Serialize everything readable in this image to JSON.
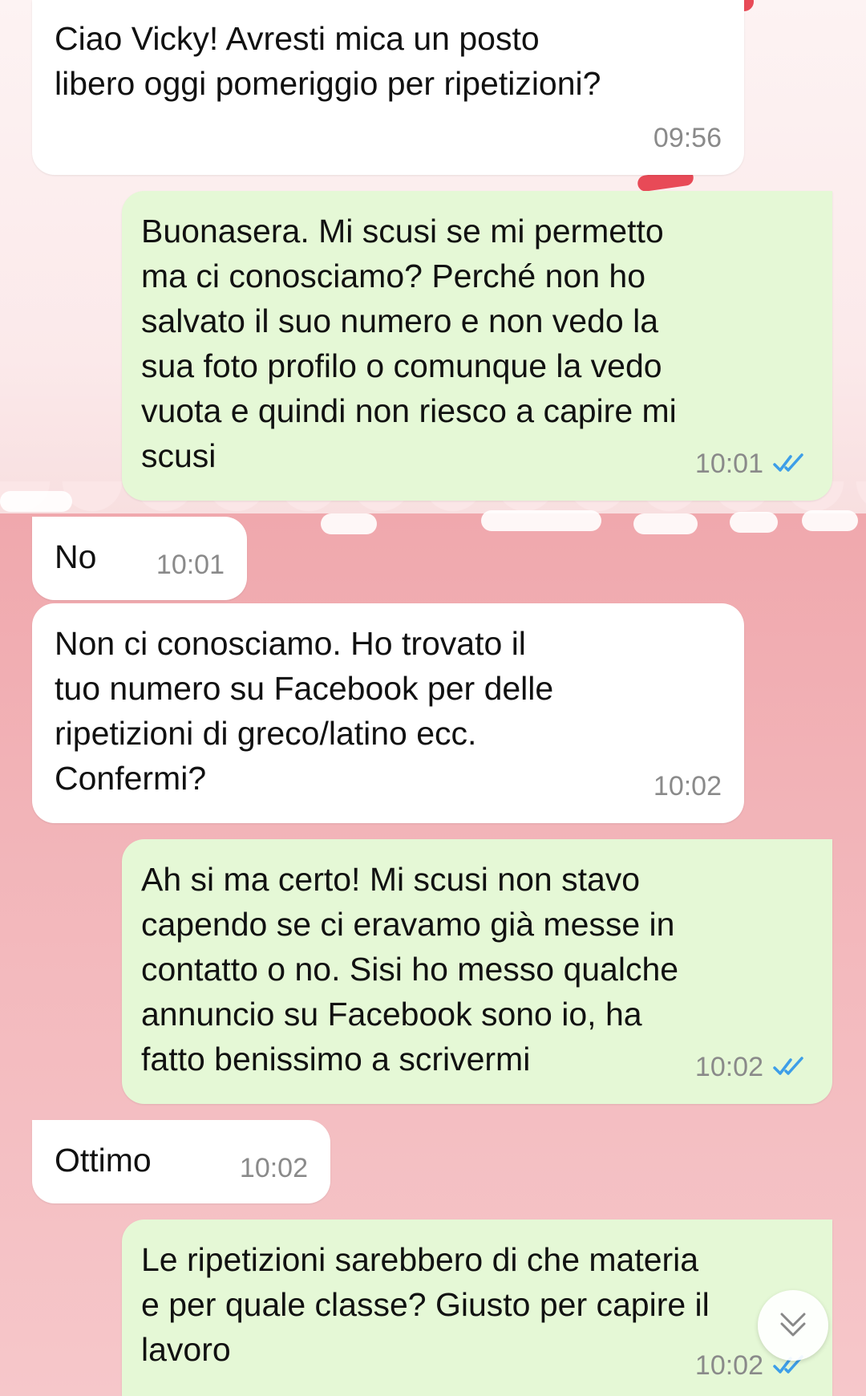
{
  "messages": [
    {
      "text": "Ciao Vicky! Avresti mica un posto\nlibero oggi pomeriggio per ripetizioni?",
      "time": "09:56",
      "direction": "incoming"
    },
    {
      "text": "Buonasera. Mi scusi se mi permetto\nma ci conosciamo? Perché non ho\nsalvato il suo numero e non vedo la\nsua foto profilo o comunque la vedo\nvuota e quindi non riesco a capire mi\nscusi",
      "time": "10:01",
      "direction": "outgoing",
      "status": "read"
    },
    {
      "text": "No",
      "time": "10:01",
      "direction": "incoming"
    },
    {
      "text": "Non ci conosciamo. Ho trovato il\ntuo numero su Facebook per delle\nripetizioni di greco/latino ecc.\nConfermi?",
      "time": "10:02",
      "direction": "incoming"
    },
    {
      "text": "Ah si ma certo! Mi scusi non stavo\ncapendo se ci eravamo già messe in\ncontatto o no. Sisi ho messo qualche\nannuncio su Facebook sono io, ha\nfatto benissimo a scrivermi",
      "time": "10:02",
      "direction": "outgoing",
      "status": "read"
    },
    {
      "text": "Ottimo",
      "time": "10:02",
      "direction": "incoming"
    },
    {
      "text": "Le ripetizioni sarebbero di che materia\ne per quale classe? Giusto per capire il\nlavoro",
      "time": "10:02",
      "direction": "outgoing",
      "status": "read"
    }
  ],
  "colors": {
    "incoming_bubble": "#ffffff",
    "outgoing_bubble": "#e5f8d6",
    "read_ticks": "#3d9ee8",
    "timestamp": "#8a8a8a"
  },
  "icons": {
    "read_status": "double-check-icon",
    "scroll_down": "double-chevron-down-icon"
  }
}
